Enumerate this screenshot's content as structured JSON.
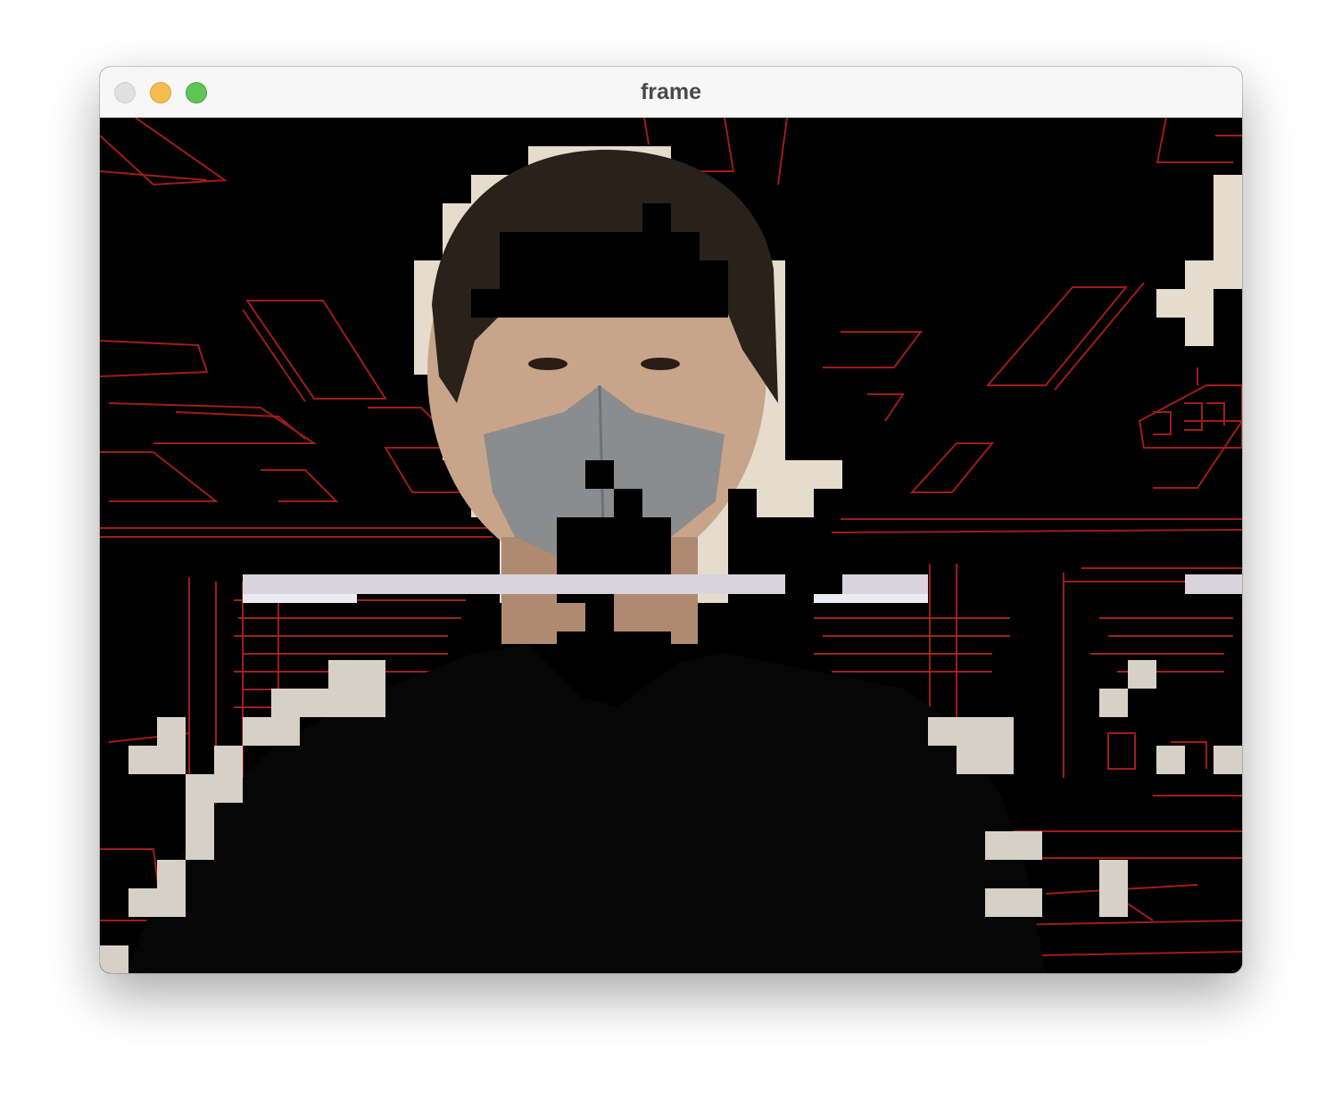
{
  "window": {
    "title": "frame"
  },
  "controls": {
    "close": "close-button",
    "minimize": "minimize-button",
    "maximize": "maximize-button"
  },
  "colors": {
    "edge_lines": "#b0231c",
    "background": "#000000",
    "close": "#e0e0e0",
    "minimize": "#f5bd4f",
    "maximize": "#5fc454"
  }
}
